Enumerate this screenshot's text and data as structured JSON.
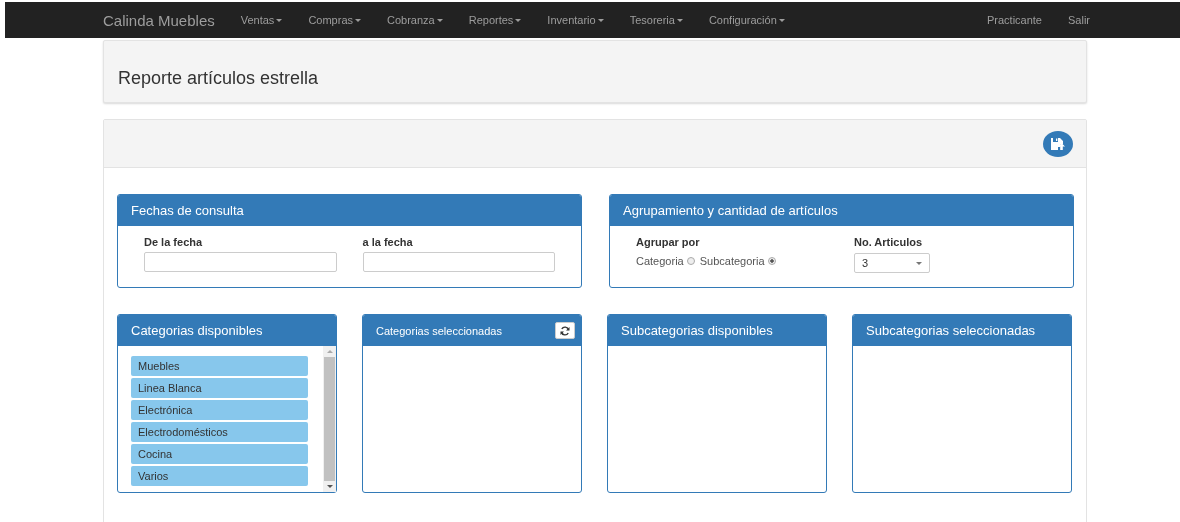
{
  "navbar": {
    "brand": "Calinda Muebles",
    "menus": [
      {
        "label": "Ventas",
        "dropdown": true
      },
      {
        "label": "Compras",
        "dropdown": true
      },
      {
        "label": "Cobranza",
        "dropdown": true
      },
      {
        "label": "Reportes",
        "dropdown": true
      },
      {
        "label": "Inventario",
        "dropdown": true
      },
      {
        "label": "Tesoreria",
        "dropdown": true
      },
      {
        "label": "Configuración",
        "dropdown": true
      }
    ],
    "right": [
      {
        "label": "Practicante",
        "dropdown": false
      },
      {
        "label": "Salir",
        "dropdown": false
      }
    ]
  },
  "page_title": "Reporte artículos estrella",
  "dates_panel": {
    "title": "Fechas de consulta",
    "fields": [
      {
        "label": "De la fecha"
      },
      {
        "label": "a la fecha"
      }
    ]
  },
  "group_panel": {
    "title": "Agrupamiento y cantidad de artículos",
    "group_label": "Agrupar por",
    "options": [
      {
        "label": "Categoria",
        "selected": false
      },
      {
        "label": "Subcategoria",
        "selected": true
      }
    ],
    "count_label": "No. Articulos",
    "count_value": "3"
  },
  "lists": [
    {
      "title": "Categorias disponibles",
      "refresh_button": false,
      "scrollbar": true,
      "items": [
        "Muebles",
        "Linea Blanca",
        "Electrónica",
        "Electrodomésticos",
        "Cocina",
        "Varios"
      ]
    },
    {
      "title": "Categorias seleccionadas",
      "refresh_button": true,
      "scrollbar": false
    },
    {
      "title": "Subcategorias disponibles",
      "refresh_button": false,
      "scrollbar": false
    },
    {
      "title": "Subcategorias seleccionadas",
      "refresh_button": false,
      "scrollbar": false
    }
  ]
}
